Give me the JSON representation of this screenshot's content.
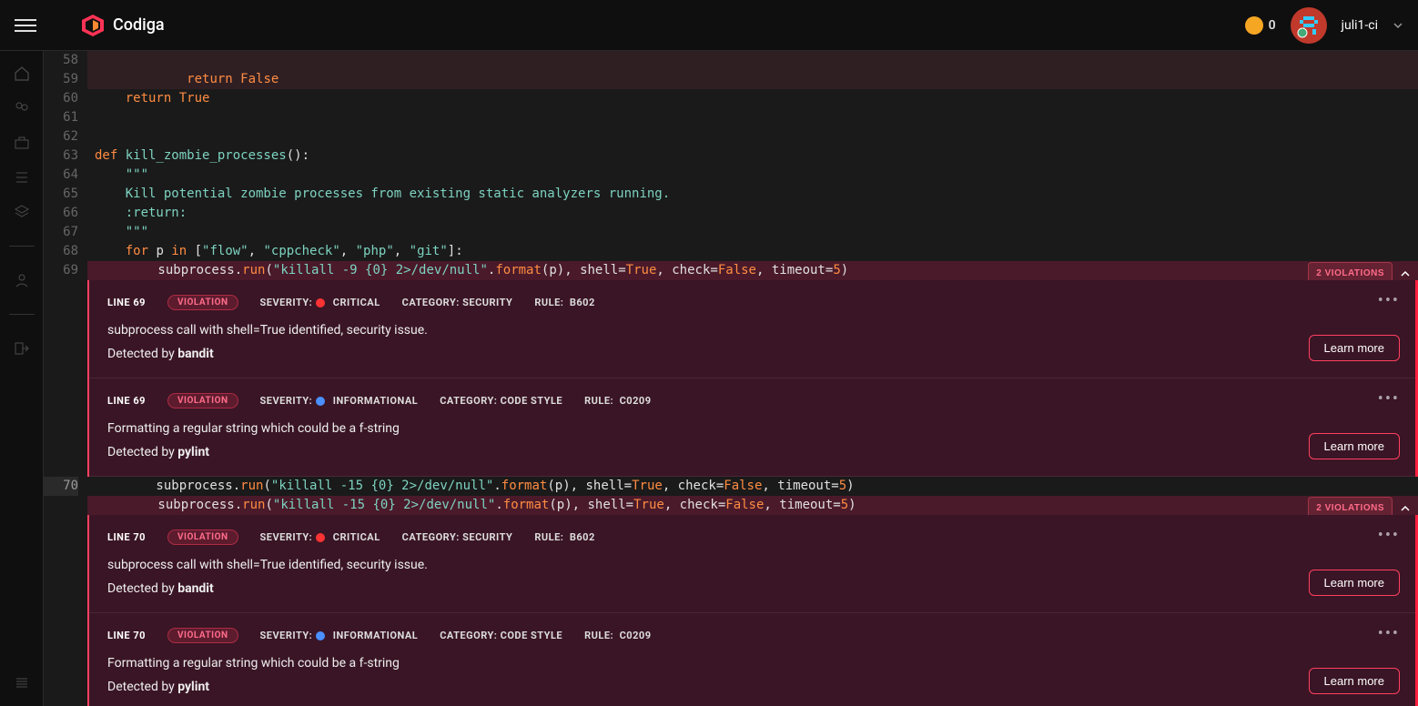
{
  "header": {
    "brand": "Codiga",
    "cookie_count": "0",
    "user_name": "juli1-ci"
  },
  "code": {
    "lines": [
      {
        "n": 58,
        "tokens": []
      },
      {
        "n": 59,
        "tokens": [
          {
            "t": "            ",
            "c": ""
          },
          {
            "t": "return ",
            "c": "kw"
          },
          {
            "t": "False",
            "c": "val"
          }
        ]
      },
      {
        "n": 60,
        "tokens": [
          {
            "t": "    ",
            "c": ""
          },
          {
            "t": "return ",
            "c": "kw"
          },
          {
            "t": "True",
            "c": "val"
          }
        ]
      },
      {
        "n": 61,
        "tokens": []
      },
      {
        "n": 62,
        "tokens": []
      },
      {
        "n": 63,
        "tokens": [
          {
            "t": "def ",
            "c": "kw"
          },
          {
            "t": "kill_zombie_processes",
            "c": "fn"
          },
          {
            "t": "():",
            "c": "punc"
          }
        ]
      },
      {
        "n": 64,
        "tokens": [
          {
            "t": "    \"\"\"",
            "c": "doc"
          }
        ]
      },
      {
        "n": 65,
        "tokens": [
          {
            "t": "    Kill potential zombie processes from existing static analyzers running.",
            "c": "doc"
          }
        ]
      },
      {
        "n": 66,
        "tokens": [
          {
            "t": "    :return:",
            "c": "doc"
          }
        ]
      },
      {
        "n": 67,
        "tokens": [
          {
            "t": "    \"\"\"",
            "c": "doc"
          }
        ]
      },
      {
        "n": 68,
        "tokens": [
          {
            "t": "    ",
            "c": ""
          },
          {
            "t": "for ",
            "c": "kw"
          },
          {
            "t": "p ",
            "c": "nm"
          },
          {
            "t": "in ",
            "c": "kw"
          },
          {
            "t": "[",
            "c": "punc"
          },
          {
            "t": "\"flow\"",
            "c": "str"
          },
          {
            "t": ", ",
            "c": "punc"
          },
          {
            "t": "\"cppcheck\"",
            "c": "str"
          },
          {
            "t": ", ",
            "c": "punc"
          },
          {
            "t": "\"php\"",
            "c": "str"
          },
          {
            "t": ", ",
            "c": "punc"
          },
          {
            "t": "\"git\"",
            "c": "str"
          },
          {
            "t": "]:",
            "c": "punc"
          }
        ]
      }
    ],
    "vio_line_69": {
      "n": 69,
      "count_label": "2 VIOLATIONS",
      "tokens": [
        {
          "t": "        subprocess.",
          "c": "nm"
        },
        {
          "t": "run",
          "c": "attr2"
        },
        {
          "t": "(",
          "c": "punc"
        },
        {
          "t": "\"killall -9 {0} 2>/dev/null\"",
          "c": "str"
        },
        {
          "t": ".",
          "c": "punc"
        },
        {
          "t": "format",
          "c": "attr2"
        },
        {
          "t": "(p), ",
          "c": "punc"
        },
        {
          "t": "shell",
          "c": "nm"
        },
        {
          "t": "=",
          "c": "punc"
        },
        {
          "t": "True",
          "c": "val"
        },
        {
          "t": ", ",
          "c": "punc"
        },
        {
          "t": "check",
          "c": "nm"
        },
        {
          "t": "=",
          "c": "punc"
        },
        {
          "t": "False",
          "c": "val"
        },
        {
          "t": ", ",
          "c": "punc"
        },
        {
          "t": "timeout",
          "c": "nm"
        },
        {
          "t": "=",
          "c": "punc"
        },
        {
          "t": "5",
          "c": "num"
        },
        {
          "t": ")",
          "c": "punc"
        }
      ]
    },
    "vio_line_70_ghost": {
      "tokens": [
        {
          "t": "        subprocess.",
          "c": "nm"
        },
        {
          "t": "run",
          "c": "attr2"
        },
        {
          "t": "(",
          "c": "punc"
        },
        {
          "t": "\"killall -15 {0} 2>/dev/null\"",
          "c": "str"
        },
        {
          "t": ".",
          "c": "punc"
        },
        {
          "t": "format",
          "c": "attr2"
        },
        {
          "t": "(p), ",
          "c": "punc"
        },
        {
          "t": "shell",
          "c": "nm"
        },
        {
          "t": "=",
          "c": "punc"
        },
        {
          "t": "True",
          "c": "val"
        },
        {
          "t": ", ",
          "c": "punc"
        },
        {
          "t": "check",
          "c": "nm"
        },
        {
          "t": "=",
          "c": "punc"
        },
        {
          "t": "False",
          "c": "val"
        },
        {
          "t": ", ",
          "c": "punc"
        },
        {
          "t": "timeout",
          "c": "nm"
        },
        {
          "t": "=",
          "c": "punc"
        },
        {
          "t": "5",
          "c": "num"
        },
        {
          "t": ")",
          "c": "punc"
        }
      ]
    },
    "vio_line_70": {
      "n": 70,
      "count_label": "2 VIOLATIONS",
      "tokens": [
        {
          "t": "        subprocess.",
          "c": "nm"
        },
        {
          "t": "run",
          "c": "attr2"
        },
        {
          "t": "(",
          "c": "punc"
        },
        {
          "t": "\"killall -15 {0} 2>/dev/null\"",
          "c": "str"
        },
        {
          "t": ".",
          "c": "punc"
        },
        {
          "t": "format",
          "c": "attr2"
        },
        {
          "t": "(p), ",
          "c": "punc"
        },
        {
          "t": "shell",
          "c": "nm"
        },
        {
          "t": "=",
          "c": "punc"
        },
        {
          "t": "True",
          "c": "val"
        },
        {
          "t": ", ",
          "c": "punc"
        },
        {
          "t": "check",
          "c": "nm"
        },
        {
          "t": "=",
          "c": "punc"
        },
        {
          "t": "False",
          "c": "val"
        },
        {
          "t": ", ",
          "c": "punc"
        },
        {
          "t": "timeout",
          "c": "nm"
        },
        {
          "t": "=",
          "c": "punc"
        },
        {
          "t": "5",
          "c": "num"
        },
        {
          "t": ")",
          "c": "punc"
        }
      ]
    }
  },
  "violations_69": [
    {
      "line": "LINE 69",
      "badge": "VIOLATION",
      "sev_label": "SEVERITY:",
      "sev": "CRITICAL",
      "sev_dot": "sev-crit",
      "cat_label": "CATEGORY: SECURITY",
      "rule_label": "RULE:",
      "rule": "B602",
      "msg": "subprocess call with shell=True identified, security issue.",
      "detect_pre": "Detected by ",
      "tool": "bandit",
      "learn": "Learn more"
    },
    {
      "line": "LINE 69",
      "badge": "VIOLATION",
      "sev_label": "SEVERITY:",
      "sev": "INFORMATIONAL",
      "sev_dot": "sev-info",
      "cat_label": "CATEGORY: CODE STYLE",
      "rule_label": "RULE:",
      "rule": "C0209",
      "msg": "Formatting a regular string which could be a f-string",
      "detect_pre": "Detected by ",
      "tool": "pylint",
      "learn": "Learn more"
    }
  ],
  "violations_70": [
    {
      "line": "LINE 70",
      "badge": "VIOLATION",
      "sev_label": "SEVERITY:",
      "sev": "CRITICAL",
      "sev_dot": "sev-crit",
      "cat_label": "CATEGORY: SECURITY",
      "rule_label": "RULE:",
      "rule": "B602",
      "msg": "subprocess call with shell=True identified, security issue.",
      "detect_pre": "Detected by ",
      "tool": "bandit",
      "learn": "Learn more"
    },
    {
      "line": "LINE 70",
      "badge": "VIOLATION",
      "sev_label": "SEVERITY:",
      "sev": "INFORMATIONAL",
      "sev_dot": "sev-info",
      "cat_label": "CATEGORY: CODE STYLE",
      "rule_label": "RULE:",
      "rule": "C0209",
      "msg": "Formatting a regular string which could be a f-string",
      "detect_pre": "Detected by ",
      "tool": "pylint",
      "learn": "Learn more"
    }
  ]
}
